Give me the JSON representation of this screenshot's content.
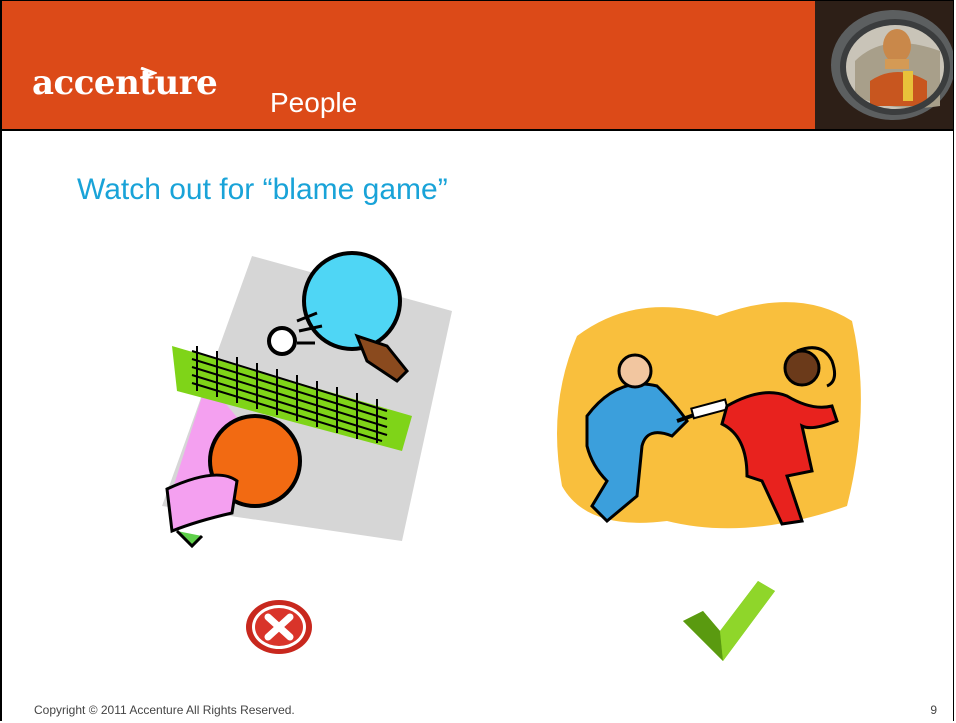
{
  "header": {
    "logo_text": "accenture",
    "section_title": "People"
  },
  "slide": {
    "subtitle": "Watch out for “blame game”"
  },
  "images": {
    "left": "ping-pong-paddles-clipart",
    "right": "relay-baton-handoff-clipart",
    "header_photo": "crash-test-dummy-in-car-mirror"
  },
  "icons": {
    "wrong": "red-x-circle-icon",
    "right": "green-checkmark-icon"
  },
  "footer": {
    "copyright": "Copyright © 2011 Accenture  All Rights Reserved.",
    "page_number": "9"
  },
  "colors": {
    "header_bg": "#dc4a18",
    "subtitle": "#19a3d8",
    "check_green": "#7ac21a",
    "x_red": "#c8281e"
  }
}
